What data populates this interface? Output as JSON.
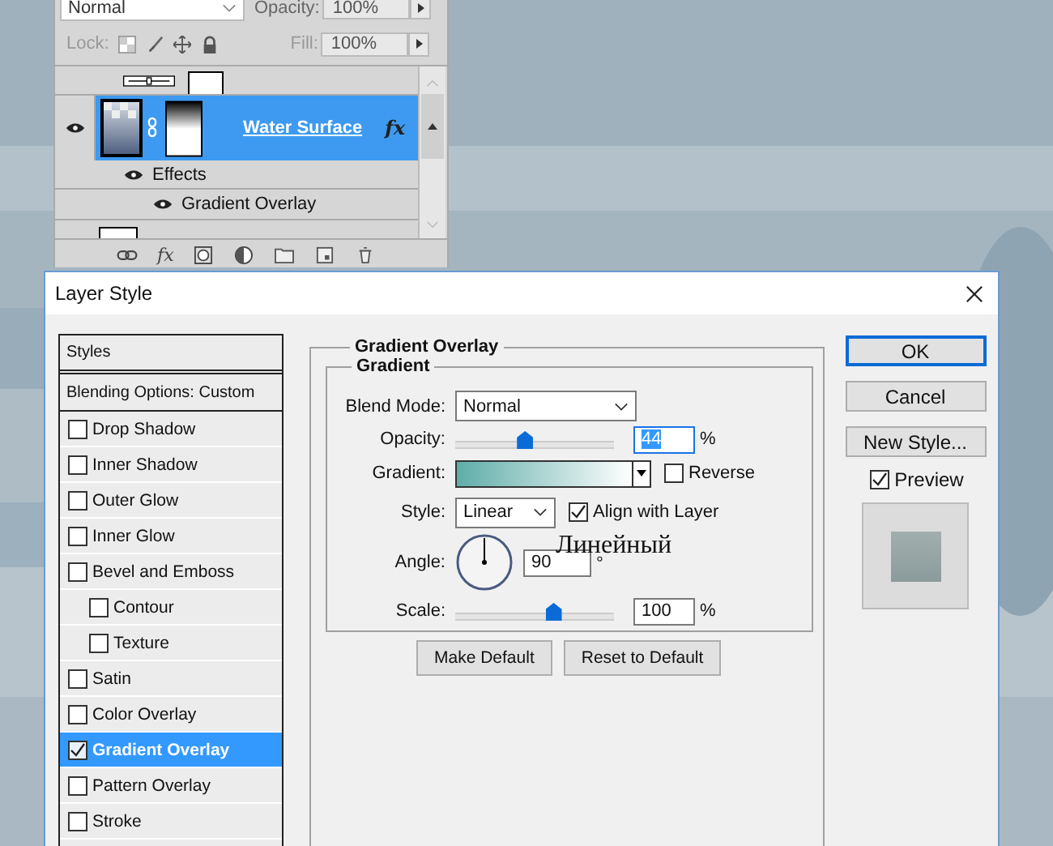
{
  "layers_panel": {
    "blend_mode": "Normal",
    "opacity_label": "Opacity:",
    "opacity": "100%",
    "lock_label": "Lock:",
    "fill_label": "Fill:",
    "fill": "100%",
    "layer": {
      "name": "Water Surface",
      "selected": true,
      "visible": true,
      "badge": "fx"
    },
    "effects_label": "Effects",
    "effects": [
      {
        "name": "Gradient Overlay",
        "visible": true
      }
    ],
    "fx_button": "fx"
  },
  "dialog": {
    "title": "Layer Style",
    "styles_header": "Styles",
    "blending_options": "Blending Options: Custom",
    "styles": [
      {
        "label": "Drop Shadow",
        "checked": false,
        "selected": false
      },
      {
        "label": "Inner Shadow",
        "checked": false,
        "selected": false
      },
      {
        "label": "Outer Glow",
        "checked": false,
        "selected": false
      },
      {
        "label": "Inner Glow",
        "checked": false,
        "selected": false
      },
      {
        "label": "Bevel and Emboss",
        "checked": false,
        "selected": false,
        "children": [
          {
            "label": "Contour",
            "checked": false,
            "selected": false
          },
          {
            "label": "Texture",
            "checked": false,
            "selected": false
          }
        ]
      },
      {
        "label": "Satin",
        "checked": false,
        "selected": false
      },
      {
        "label": "Color Overlay",
        "checked": false,
        "selected": false
      },
      {
        "label": "Gradient Overlay",
        "checked": true,
        "selected": true
      },
      {
        "label": "Pattern Overlay",
        "checked": false,
        "selected": false
      },
      {
        "label": "Stroke",
        "checked": false,
        "selected": false
      }
    ],
    "section_title": "Gradient Overlay",
    "group_title": "Gradient",
    "blend_mode_label": "Blend Mode:",
    "blend_mode": "Normal",
    "opacity_label": "Opacity:",
    "opacity": {
      "level": 0.44,
      "value": "44",
      "unit": "%"
    },
    "gradient_label": "Gradient:",
    "reverse": {
      "label": "Reverse",
      "checked": false
    },
    "style_label": "Style:",
    "style": "Linear",
    "align": {
      "label": "Align with Layer",
      "checked": true
    },
    "annotation": "Линейный",
    "angle_label": "Angle:",
    "angle": "90",
    "angle_unit": "°",
    "scale_label": "Scale:",
    "scale": {
      "level": 0.62,
      "value": "100",
      "unit": "%"
    },
    "buttons": [
      "Make Default",
      "Reset to Default"
    ],
    "side_buttons": [
      {
        "label": "OK",
        "default": true
      },
      {
        "label": "Cancel",
        "default": false
      },
      {
        "label": "New Style...",
        "default": false
      }
    ],
    "preview": {
      "label": "Preview",
      "checked": true
    }
  }
}
